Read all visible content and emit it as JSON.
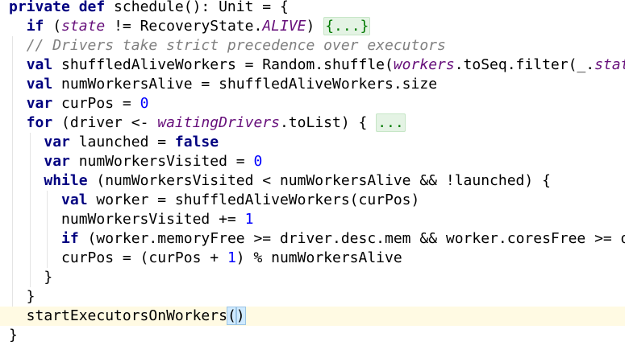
{
  "editor": {
    "language": "Scala",
    "current_line_index": 16,
    "colors": {
      "keyword": "#000080",
      "number": "#0000ff",
      "comment": "#808080",
      "field": "#660e7a",
      "fold": "#007a00",
      "current_line_bg": "#fffae3"
    },
    "lines": [
      {
        "tokens": [
          {
            "t": "private def",
            "c": "kw"
          },
          {
            "t": " schedule(): Unit = {"
          }
        ]
      },
      {
        "tokens": [
          {
            "t": "  "
          },
          {
            "t": "if",
            "c": "kw"
          },
          {
            "t": " ("
          },
          {
            "t": "state",
            "c": "fld"
          },
          {
            "t": " != RecoveryState."
          },
          {
            "t": "ALIVE",
            "c": "fld"
          },
          {
            "t": ") "
          },
          {
            "t": "{...}",
            "c": "fold"
          }
        ]
      },
      {
        "tokens": [
          {
            "t": "  "
          },
          {
            "t": "// Drivers take strict precedence over executors",
            "c": "cmt"
          }
        ]
      },
      {
        "tokens": [
          {
            "t": "  "
          },
          {
            "t": "val",
            "c": "kw"
          },
          {
            "t": " shuffledAliveWorkers = Random.shuffle("
          },
          {
            "t": "workers",
            "c": "fld"
          },
          {
            "t": ".toSeq.filter(_."
          },
          {
            "t": "state",
            "c": "fld"
          }
        ]
      },
      {
        "tokens": [
          {
            "t": "  "
          },
          {
            "t": "val",
            "c": "kw"
          },
          {
            "t": " numWorkersAlive = shuffledAliveWorkers.size"
          }
        ]
      },
      {
        "tokens": [
          {
            "t": "  "
          },
          {
            "t": "var",
            "c": "kw"
          },
          {
            "t": " curPos = "
          },
          {
            "t": "0",
            "c": "num"
          }
        ]
      },
      {
        "tokens": [
          {
            "t": "  "
          },
          {
            "t": "for",
            "c": "kw"
          },
          {
            "t": " (driver <- "
          },
          {
            "t": "waitingDrivers",
            "c": "fld"
          },
          {
            "t": ".toList) { "
          },
          {
            "t": "...",
            "c": "fold"
          }
        ]
      },
      {
        "tokens": [
          {
            "t": "    "
          },
          {
            "t": "var",
            "c": "kw"
          },
          {
            "t": " launched = "
          },
          {
            "t": "false",
            "c": "kw"
          }
        ]
      },
      {
        "tokens": [
          {
            "t": "    "
          },
          {
            "t": "var",
            "c": "kw"
          },
          {
            "t": " numWorkersVisited = "
          },
          {
            "t": "0",
            "c": "num"
          }
        ]
      },
      {
        "tokens": [
          {
            "t": "    "
          },
          {
            "t": "while",
            "c": "kw"
          },
          {
            "t": " (numWorkersVisited < numWorkersAlive && !launched) {"
          }
        ]
      },
      {
        "tokens": [
          {
            "t": "      "
          },
          {
            "t": "val",
            "c": "kw"
          },
          {
            "t": " worker = shuffledAliveWorkers(curPos)"
          }
        ]
      },
      {
        "tokens": [
          {
            "t": "      numWorkersVisited += "
          },
          {
            "t": "1",
            "c": "num"
          }
        ]
      },
      {
        "tokens": [
          {
            "t": "      "
          },
          {
            "t": "if",
            "c": "kw"
          },
          {
            "t": " (worker.memoryFree >= driver.desc.mem && worker.coresFree >= dri"
          }
        ]
      },
      {
        "tokens": [
          {
            "t": "      curPos = (curPos + "
          },
          {
            "t": "1",
            "c": "num"
          },
          {
            "t": ") % numWorkersAlive"
          }
        ]
      },
      {
        "tokens": [
          {
            "t": "    }"
          }
        ]
      },
      {
        "tokens": [
          {
            "t": "  }"
          }
        ]
      },
      {
        "tokens": [
          {
            "t": "  startExecutorsOnWorkers"
          },
          {
            "t": "(",
            "c": "bracket"
          },
          {
            "t": ")",
            "c": "bracket"
          }
        ]
      },
      {
        "tokens": [
          {
            "t": "}"
          }
        ]
      }
    ]
  }
}
